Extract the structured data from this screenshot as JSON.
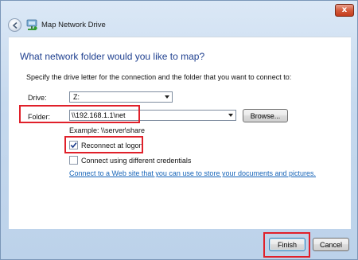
{
  "window": {
    "title": "Map Network Drive",
    "close_glyph": "x"
  },
  "heading": "What network folder would you like to map?",
  "instruction": "Specify the drive letter for the connection and the folder that you want to connect to:",
  "drive": {
    "label": "Drive:",
    "value": "Z:"
  },
  "folder": {
    "label": "Folder:",
    "value": "\\\\192.168.1.1\\net",
    "example": "Example: \\\\server\\share",
    "browse_label": "Browse..."
  },
  "options": {
    "reconnect": {
      "label": "Reconnect at logon",
      "checked": true
    },
    "different_credentials": {
      "label": "Connect using different credentials",
      "checked": false
    }
  },
  "link_text": "Connect to a Web site that you can use to store your documents and pictures.",
  "buttons": {
    "finish": "Finish",
    "cancel": "Cancel"
  },
  "colors": {
    "heading": "#1e3f8f",
    "link": "#1664b8",
    "highlight_box": "#e0202a"
  },
  "icons": [
    "back-arrow-icon",
    "network-drive-icon",
    "close-icon",
    "checkmark-icon",
    "dropdown-arrow-icon"
  ]
}
